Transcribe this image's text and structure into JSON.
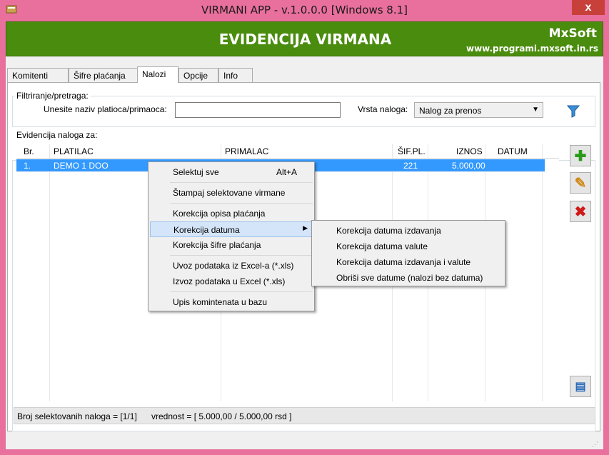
{
  "window": {
    "title": "VIRMANI APP - v.1.0.0.0  [Windows 8.1]",
    "close_glyph": "x",
    "accent_color": "#e96f9c"
  },
  "banner": {
    "title": "EVIDENCIJA VIRMANA",
    "brand": "MxSoft",
    "url": "www.programi.mxsoft.in.rs",
    "color": "#4a8c0e"
  },
  "tabs": [
    {
      "label": "Komitenti"
    },
    {
      "label": "Šifre plaćanja"
    },
    {
      "label": "Nalozi"
    },
    {
      "label": "Opcije"
    },
    {
      "label": "Info"
    }
  ],
  "filter": {
    "legend": "Filtriranje/pretraga:",
    "search_label": "Unesite naziv platioca/primaoca:",
    "search_value": "",
    "type_label": "Vrsta naloga:",
    "type_value": "Nalog za prenos"
  },
  "records": {
    "legend": "Evidencija naloga za:",
    "columns": [
      "Br.",
      "PLATILAC",
      "PRIMALAC",
      "ŠIF.PL.",
      "IZNOS",
      "DATUM"
    ],
    "rows": [
      {
        "br": "1.",
        "platilac": "DEMO 1 DOO",
        "primalac": "",
        "sif": "221",
        "iznos": "5.000,00",
        "datum": ""
      }
    ]
  },
  "status": {
    "selected": "Broj selektovanih naloga = [1/1]",
    "value": "vrednost = [ 5.000,00 / 5.000,00 rsd ]"
  },
  "context_menu": {
    "items": [
      {
        "label": "Selektuj sve",
        "shortcut": "Alt+A"
      },
      {
        "label": "Štampaj selektovane virmane"
      },
      {
        "label": "Korekcija opisa plaćanja"
      },
      {
        "label": "Korekcija datuma"
      },
      {
        "label": "Korekcija šifre plaćanja"
      },
      {
        "label": "Uvoz podataka iz Excel-a (*.xls)"
      },
      {
        "label": "Izvoz podataka u Excel (*.xls)"
      },
      {
        "label": "Upis komintenata u bazu"
      }
    ]
  },
  "submenu": {
    "items": [
      {
        "label": "Korekcija datuma izdavanja"
      },
      {
        "label": "Korekcija datuma valute"
      },
      {
        "label": "Korekcija datuma izdavanja i valute"
      },
      {
        "label": "Obriši sve datume (nalozi bez datuma)"
      }
    ]
  },
  "icons": {
    "add": "plus-icon",
    "edit": "pencil-icon",
    "delete": "x-icon",
    "print": "printer-icon",
    "filter": "funnel-icon"
  }
}
